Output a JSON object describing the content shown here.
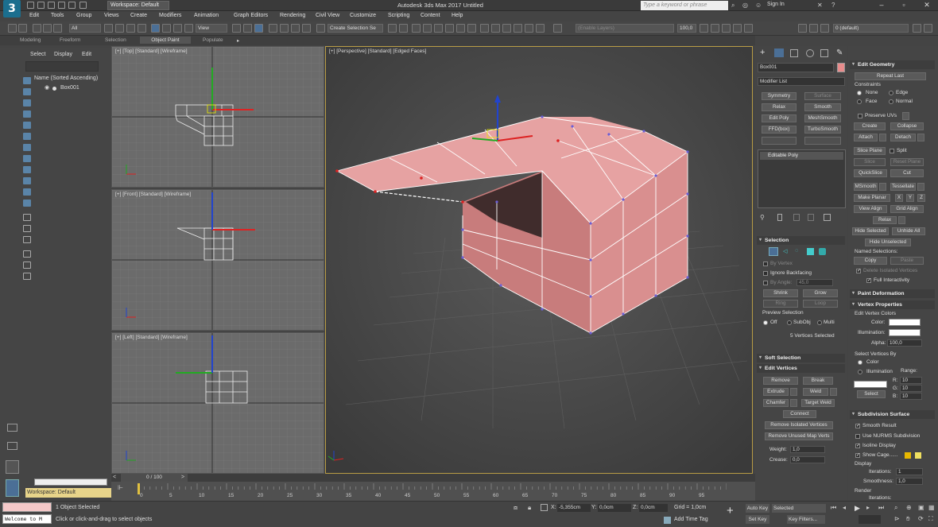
{
  "window": {
    "title": "Autodesk 3ds Max 2017    Untitled",
    "workspace": "Workspace: Default",
    "search_placeholder": "Type a keyword or phrase",
    "sign_in": "Sign In"
  },
  "menu": [
    "Edit",
    "Tools",
    "Group",
    "Views",
    "Create",
    "Modifiers",
    "Animation",
    "Graph Editors",
    "Rendering",
    "Civil View",
    "Customize",
    "Scripting",
    "Content",
    "Help"
  ],
  "toolbar": {
    "filter": "All",
    "ref_coord": "View",
    "selection_set": "Create Selection Se",
    "layers": "(Enable Layers)",
    "zoom": "100,0",
    "layer_default": "0 (default)"
  },
  "ribbon_tabs": [
    "Modeling",
    "Freeform",
    "Selection",
    "Object Paint",
    "Populate"
  ],
  "scene_explorer": {
    "tabs": [
      "Select",
      "Display",
      "Edit"
    ],
    "header": "Name (Sorted Ascending)",
    "row": "Box001",
    "workspace": "Workspace: Default"
  },
  "viewports": {
    "top": "[+] [Top] [Standard] [Wireframe]",
    "front": "[+] [Front] [Standard] [Wireframe]",
    "left": "[+] [Left] [Standard] [Wireframe]",
    "persp": "[+] [Perspective] [Standard] [Edged Faces]"
  },
  "modify": {
    "object_name": "Box001",
    "object_color": "#e88c8c",
    "modifier_list": "Modifier List",
    "modifier_buttons": [
      "Symmetry",
      "Surface",
      "Relax",
      "Smooth",
      "Edit Poly",
      "MeshSmooth",
      "FFD(box)",
      "TurboSmooth"
    ],
    "stack_item": "Editable Poly",
    "selection": {
      "title": "Selection",
      "by_vertex": "By Vertex",
      "ignore_backfacing": "Ignore Backfacing",
      "by_angle": "By Angle:",
      "angle_value": "45,0",
      "shrink": "Shrink",
      "grow": "Grow",
      "ring": "Ring",
      "loop": "Loop",
      "preview": "Preview Selection",
      "preview_off": "Off",
      "preview_subobj": "SubObj",
      "preview_multi": "Multi",
      "status": "5 Vertices Selected"
    },
    "soft_selection": "Soft Selection",
    "edit_vertices": {
      "title": "Edit Vertices",
      "remove": "Remove",
      "break": "Break",
      "extrude": "Extrude",
      "weld": "Weld",
      "chamfer": "Chamfer",
      "target_weld": "Target Weld",
      "connect": "Connect",
      "remove_isolated": "Remove Isolated Vertices",
      "remove_unused": "Remove Unused Map Verts",
      "weight_label": "Weight:",
      "weight": "1,0",
      "crease_label": "Crease:",
      "crease": "0,0"
    },
    "edit_geometry": {
      "title": "Edit Geometry",
      "repeat_last": "Repeat Last",
      "constraints": "Constraints",
      "none": "None",
      "edge": "Edge",
      "face": "Face",
      "normal": "Normal",
      "preserve_uvs": "Preserve UVs",
      "create": "Create",
      "collapse": "Collapse",
      "attach": "Attach",
      "detach": "Detach",
      "slice_plane": "Slice Plane",
      "split": "Split",
      "slice": "Slice",
      "reset_plane": "Reset Plane",
      "quickslice": "QuickSlice",
      "cut": "Cut",
      "msmooth": "MSmooth",
      "tessellate": "Tessellate",
      "make_planar": "Make Planar",
      "x": "X",
      "y": "Y",
      "z": "Z",
      "view_align": "View Align",
      "grid_align": "Grid Align",
      "relax": "Relax",
      "hide_selected": "Hide Selected",
      "unhide_all": "Unhide All",
      "hide_unselected": "Hide Unselected",
      "named_selections": "Named Selections:",
      "copy": "Copy",
      "paste": "Paste",
      "delete_isolated": "Delete Isolated Vertices",
      "full_interactivity": "Full Interactivity"
    },
    "paint_deformation": "Paint Deformation",
    "vertex_properties": {
      "title": "Vertex Properties",
      "edit_colors": "Edit Vertex Colors",
      "color": "Color:",
      "illumination": "Illumination:",
      "alpha": "Alpha:",
      "alpha_value": "100,0",
      "select_by": "Select Vertices By",
      "by_color": "Color",
      "by_illumination": "Illumination",
      "range": "Range:",
      "r": "R:",
      "g": "G:",
      "b": "B:",
      "r_val": "10",
      "g_val": "10",
      "b_val": "10",
      "select": "Select"
    },
    "subdivision": {
      "title": "Subdivision Surface",
      "smooth_result": "Smooth Result",
      "use_nurms": "Use NURMS Subdivision",
      "isoline": "Isoline Display",
      "show_cage": "Show Cage......",
      "display": "Display",
      "iterations": "Iterations:",
      "iterations_val": "1",
      "smoothness": "Smoothness:",
      "smoothness_val": "1,0",
      "render": "Render",
      "iterations2": "Iterations:"
    }
  },
  "timeline": {
    "frame": "0 / 100",
    "ticks": [
      "0",
      "5",
      "10",
      "15",
      "20",
      "25",
      "30",
      "35",
      "40",
      "45",
      "50",
      "55",
      "60",
      "65",
      "70",
      "75",
      "80",
      "85",
      "90",
      "95",
      "100"
    ]
  },
  "status": {
    "welcome": "Welcome to M",
    "selected": "1 Object Selected",
    "hint": "Click or click-and-drag to select objects",
    "x_label": "X:",
    "x": "-5,355cm",
    "y_label": "Y:",
    "y": "0,0cm",
    "z_label": "Z:",
    "z": "0,0cm",
    "grid": "Grid = 1,0cm",
    "add_time_tag": "Add Time Tag",
    "auto_key": "Auto Key",
    "set_key": "Set Key",
    "selected_set": "Selected",
    "key_filters": "Key Filters..."
  }
}
